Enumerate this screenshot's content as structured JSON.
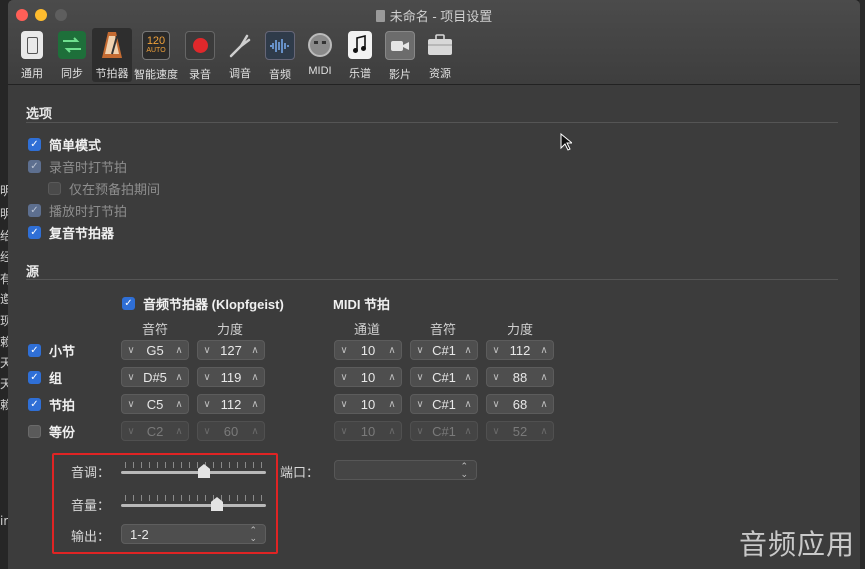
{
  "window": {
    "title": "未命名 - 项目设置"
  },
  "background_app": {
    "side_chars": [
      "明",
      "明",
      "给",
      "经",
      "有",
      "遵",
      "现",
      "赖",
      "天",
      "天",
      "赖",
      "ir"
    ]
  },
  "toolbar": {
    "items": [
      {
        "label": "通用",
        "icon": "general-switch-icon"
      },
      {
        "label": "同步",
        "icon": "sync-arrows-icon"
      },
      {
        "label": "节拍器",
        "icon": "metronome-icon",
        "active": true
      },
      {
        "label": "智能速度",
        "icon": "smart-tempo-icon",
        "badge_top": "120",
        "badge_bottom": "AUTO"
      },
      {
        "label": "录音",
        "icon": "record-icon"
      },
      {
        "label": "调音",
        "icon": "tuning-fork-icon"
      },
      {
        "label": "音频",
        "icon": "audio-waveform-icon"
      },
      {
        "label": "MIDI",
        "icon": "midi-port-icon"
      },
      {
        "label": "乐谱",
        "icon": "score-note-icon"
      },
      {
        "label": "影片",
        "icon": "movie-camera-icon"
      },
      {
        "label": "资源",
        "icon": "assets-briefcase-icon"
      }
    ]
  },
  "options": {
    "title": "选项",
    "items": [
      {
        "label": "简单模式",
        "checked": true,
        "enabled": true
      },
      {
        "label": "录音时打节拍",
        "checked": true,
        "enabled": false
      },
      {
        "label": "仅在预备拍期间",
        "checked": false,
        "enabled": false
      },
      {
        "label": "播放时打节拍",
        "checked": true,
        "enabled": false
      },
      {
        "label": "复音节拍器",
        "checked": true,
        "enabled": true
      }
    ]
  },
  "source": {
    "title": "源",
    "audio_click": {
      "label": "音频节拍器 (Klopfgeist)",
      "checked": true
    },
    "midi_click": {
      "label": "MIDI 节拍"
    },
    "audio_cols": [
      "音符",
      "力度"
    ],
    "midi_cols": [
      "通道",
      "音符",
      "力度"
    ],
    "rows": [
      {
        "label": "小节",
        "checked": true,
        "note": "G5",
        "velocity": "127",
        "midi_channel": "10",
        "midi_note": "C#1",
        "midi_velocity": "112",
        "enabled": true
      },
      {
        "label": "组",
        "checked": true,
        "note": "D#5",
        "velocity": "119",
        "midi_channel": "10",
        "midi_note": "C#1",
        "midi_velocity": "88",
        "enabled": true
      },
      {
        "label": "节拍",
        "checked": true,
        "note": "C5",
        "velocity": "112",
        "midi_channel": "10",
        "midi_note": "C#1",
        "midi_velocity": "68",
        "enabled": true
      },
      {
        "label": "等份",
        "checked": false,
        "note": "C2",
        "velocity": "60",
        "midi_channel": "10",
        "midi_note": "C#1",
        "midi_velocity": "52",
        "enabled": false
      }
    ],
    "tone_label": "音调：",
    "tone_level": 0.58,
    "volume_label": "音量：",
    "volume_level": 0.68,
    "output_label": "输出：",
    "output_value": "1-2",
    "port_label": "端口：",
    "port_value": ""
  },
  "watermark": "音频应用",
  "colors": {
    "accent": "#2f6fd6",
    "highlight_box": "#e02424",
    "record": "#e0282b"
  }
}
